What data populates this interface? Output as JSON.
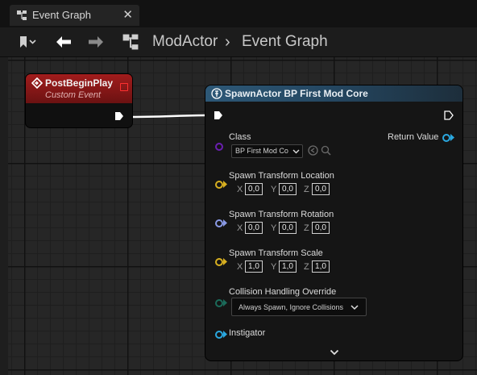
{
  "tab": {
    "title": "Event Graph",
    "close_glyph": "✕"
  },
  "breadcrumb": {
    "root": "ModActor",
    "separator": "›",
    "current": "Event Graph"
  },
  "event_node": {
    "title": "PostBeginPlay",
    "subtitle": "Custom Event"
  },
  "spawn_node": {
    "title": "SpawnActor BP First Mod Core",
    "class_label": "Class",
    "class_value": "BP First Mod Co",
    "return_label": "Return Value",
    "location": {
      "label": "Spawn Transform Location",
      "x": "0,0",
      "y": "0,0",
      "z": "0,0"
    },
    "rotation": {
      "label": "Spawn Transform Rotation",
      "x": "0,0",
      "y": "0,0",
      "z": "0,0"
    },
    "scale": {
      "label": "Spawn Transform Scale",
      "x": "1,0",
      "y": "1,0",
      "z": "1,0"
    },
    "axis_labels": {
      "x": "X",
      "y": "Y",
      "z": "Z"
    },
    "collision": {
      "label": "Collision Handling Override",
      "value": "Always Spawn, Ignore Collisions"
    },
    "instigator_label": "Instigator"
  },
  "colors": {
    "event_header": "#a21c1c",
    "spawn_header": "#2d5877",
    "pin_vector": "#d8b020",
    "pin_rotator": "#8a9ae6",
    "pin_object": "#2aa8e0",
    "pin_class": "#6a1fb0",
    "pin_enum": "#1b6b5a"
  }
}
